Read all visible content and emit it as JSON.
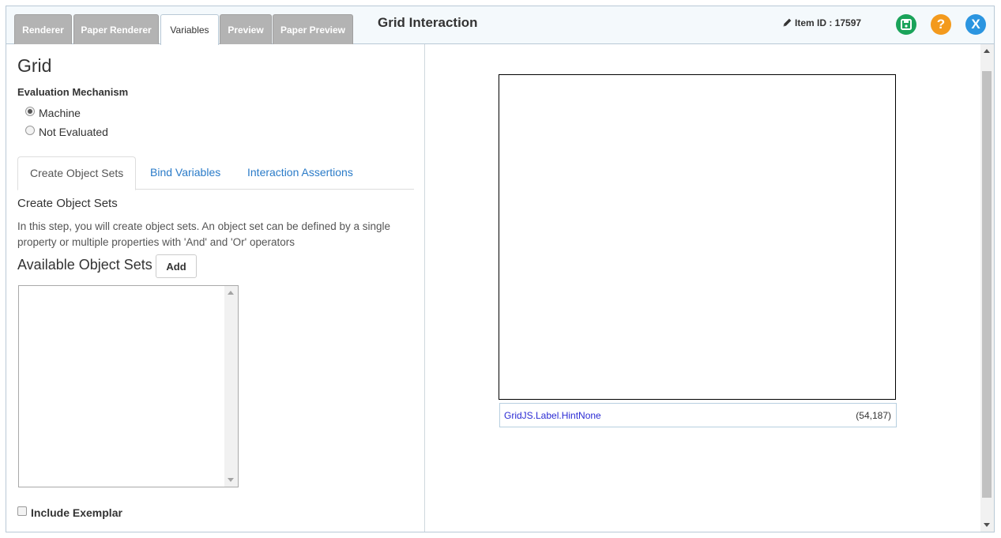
{
  "header": {
    "tabs": [
      {
        "label": "Renderer",
        "active": false
      },
      {
        "label": "Paper Renderer",
        "active": false
      },
      {
        "label": "Variables",
        "active": true
      },
      {
        "label": "Preview",
        "active": false
      },
      {
        "label": "Paper Preview",
        "active": false
      }
    ],
    "title": "Grid Interaction",
    "item_id_label": "Item ID : 17597",
    "icons": {
      "edit": "pencil-icon",
      "save": "floppy-disk-icon",
      "help": "question-icon",
      "close": "x-icon"
    },
    "help_glyph": "?",
    "close_glyph": "X",
    "colors": {
      "save": "#1aa35a",
      "help": "#f39a1d",
      "close": "#2b95e0"
    }
  },
  "left": {
    "title": "Grid",
    "evaluation_label": "Evaluation Mechanism",
    "radios": [
      {
        "label": "Machine",
        "checked": true
      },
      {
        "label": "Not Evaluated",
        "checked": false
      }
    ],
    "subtabs": [
      {
        "label": "Create Object Sets",
        "active": true
      },
      {
        "label": "Bind Variables",
        "active": false
      },
      {
        "label": "Interaction Assertions",
        "active": false
      }
    ],
    "section_title": "Create Object Sets",
    "description": "In this step, you will create object sets. An object set can be defined by a single property or multiple properties with 'And' and 'Or' operators",
    "available_title": "Available Object Sets",
    "add_label": "Add",
    "include_exemplar_label": "Include Exemplar",
    "include_exemplar_checked": false
  },
  "right": {
    "hint_label": "GridJS.Label.HintNone",
    "coords": "(54,187)"
  }
}
